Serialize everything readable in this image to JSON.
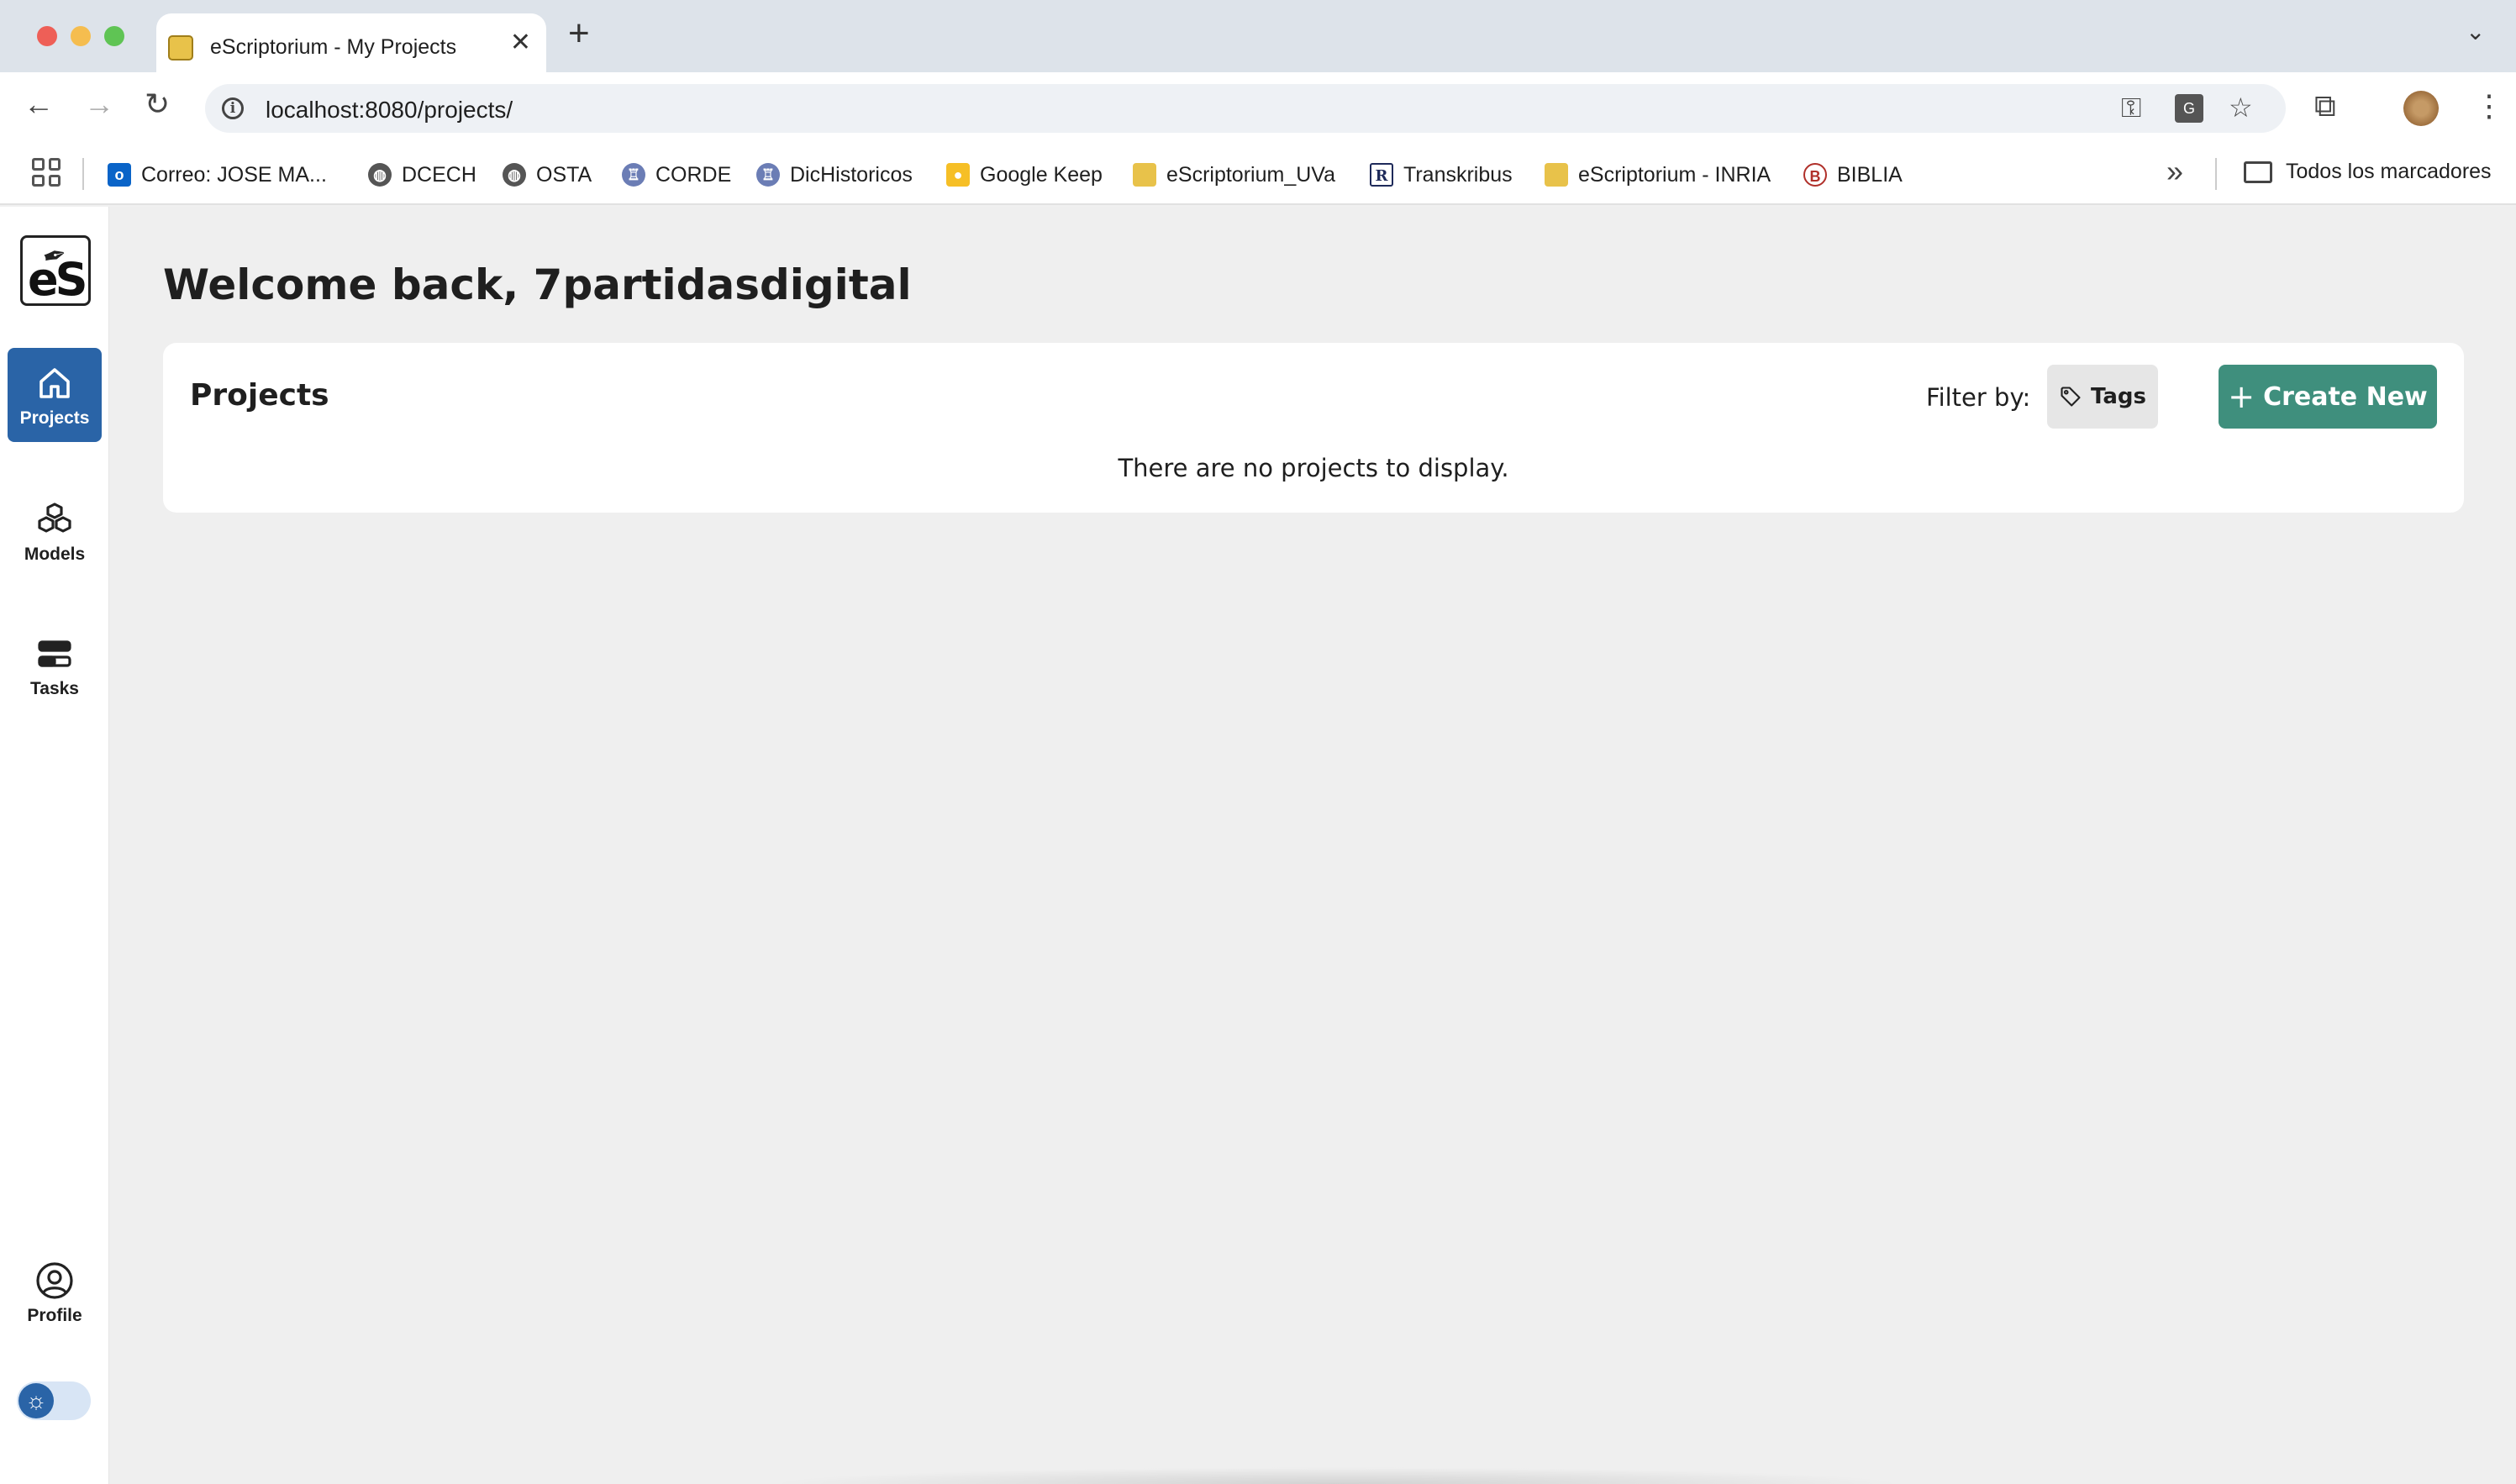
{
  "browser": {
    "tab": {
      "title": "eScriptorium - My Projects"
    },
    "url": "localhost:8080/projects/",
    "bookmarks": [
      {
        "label": "Correo: JOSE MA...",
        "icon": "outlook-icon",
        "color": "#0a64c8"
      },
      {
        "label": "DCECH",
        "icon": "globe-icon",
        "color": "#555555"
      },
      {
        "label": "OSTA",
        "icon": "globe-icon",
        "color": "#555555"
      },
      {
        "label": "CORDE",
        "icon": "rae-icon",
        "color": "#6b7db5"
      },
      {
        "label": "DicHistoricos",
        "icon": "rae-icon",
        "color": "#6b7db5"
      },
      {
        "label": "Google Keep",
        "icon": "keep-icon",
        "color": "#f6bf26"
      },
      {
        "label": "eScriptorium_UVa",
        "icon": "escriptorium-icon",
        "color": "#e8c24a"
      },
      {
        "label": "Transkribus",
        "icon": "transkribus-icon",
        "color": "#1e2a5a"
      },
      {
        "label": "eScriptorium - INRIA",
        "icon": "escriptorium-icon",
        "color": "#e8c24a"
      },
      {
        "label": "BIBLIA",
        "icon": "biblia-icon",
        "color": "#b0302a"
      }
    ],
    "all_bookmarks_label": "Todos los marcadores"
  },
  "sidebar": {
    "items": [
      {
        "label": "Projects",
        "icon": "home-icon",
        "active": true
      },
      {
        "label": "Models",
        "icon": "cubes-icon",
        "active": false
      },
      {
        "label": "Tasks",
        "icon": "tasks-icon",
        "active": false
      },
      {
        "label": "Profile",
        "icon": "user-circle-icon",
        "active": false
      }
    ]
  },
  "main": {
    "welcome": "Welcome back, 7partidasdigital",
    "projects_card": {
      "title": "Projects",
      "filter_label": "Filter by:",
      "tags_button": "Tags",
      "create_button": "Create New",
      "empty_message": "There are no projects to display."
    }
  },
  "colors": {
    "accent": "#2a64a7",
    "create_button": "#3f8f7d"
  }
}
